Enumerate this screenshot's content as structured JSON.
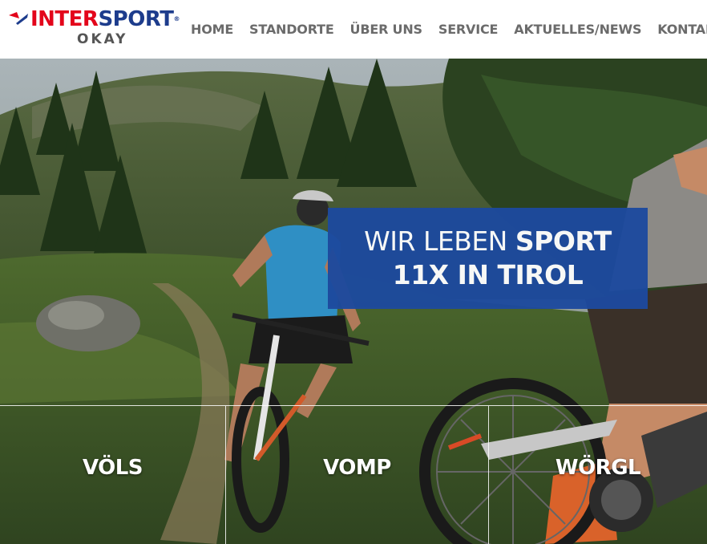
{
  "logo": {
    "brand_prefix": "INTER",
    "brand_suffix": "SPORT",
    "registered": "®",
    "sub": "OKAY"
  },
  "nav": [
    {
      "label": "HOME"
    },
    {
      "label": "STANDORTE"
    },
    {
      "label": "ÜBER UNS"
    },
    {
      "label": "SERVICE"
    },
    {
      "label": "AKTUELLES/NEWS"
    },
    {
      "label": "KONTAKT"
    }
  ],
  "hero": {
    "claim_line1_regular": "WIR LEBEN ",
    "claim_line1_bold": "SPORT",
    "claim_line2": "11X IN TIROL"
  },
  "locations": [
    {
      "label": "VÖLS"
    },
    {
      "label": "VOMP"
    },
    {
      "label": "WÖRGL"
    }
  ],
  "colors": {
    "brand_blue": "#1d3c8c",
    "brand_red": "#e3051b",
    "claim_bg": "#1d4a9e",
    "nav_text": "#6b6b6b"
  }
}
